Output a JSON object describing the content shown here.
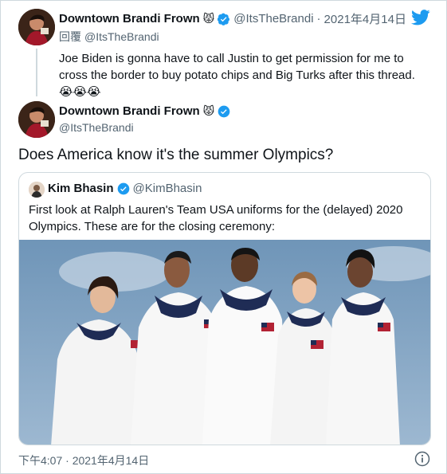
{
  "reply_tweet": {
    "display_name": "Downtown Brandi Frown",
    "name_emoji": "😾",
    "handle": "@ItsTheBrandi",
    "separator": "·",
    "date": "2021年4月14日",
    "replying_prefix": "回覆",
    "replying_to": "@ItsTheBrandi",
    "text": "Joe Biden is gonna have to call Justin to get permission for me to cross the border to buy potato chips and Big Turks after this thread.",
    "text_emojis": "😭😭😭"
  },
  "main_tweet": {
    "display_name": "Downtown Brandi Frown",
    "name_emoji": "😾",
    "handle": "@ItsTheBrandi",
    "text": "Does America know it's the summer Olympics?",
    "timestamp": "下午4:07 · 2021年4月14日"
  },
  "quoted_tweet": {
    "display_name": "Kim Bhasin",
    "handle": "@KimBhasin",
    "text": "First look at Ralph Lauren's Team USA uniforms for the (delayed) 2020 Olympics. These are for the closing ceremony:"
  },
  "colors": {
    "twitter_blue": "#1d9bf0",
    "text": "#0f1419",
    "muted": "#536471",
    "border": "#cfd9de"
  },
  "icons": [
    "twitter-bird-icon",
    "verified-badge-icon",
    "info-icon"
  ]
}
